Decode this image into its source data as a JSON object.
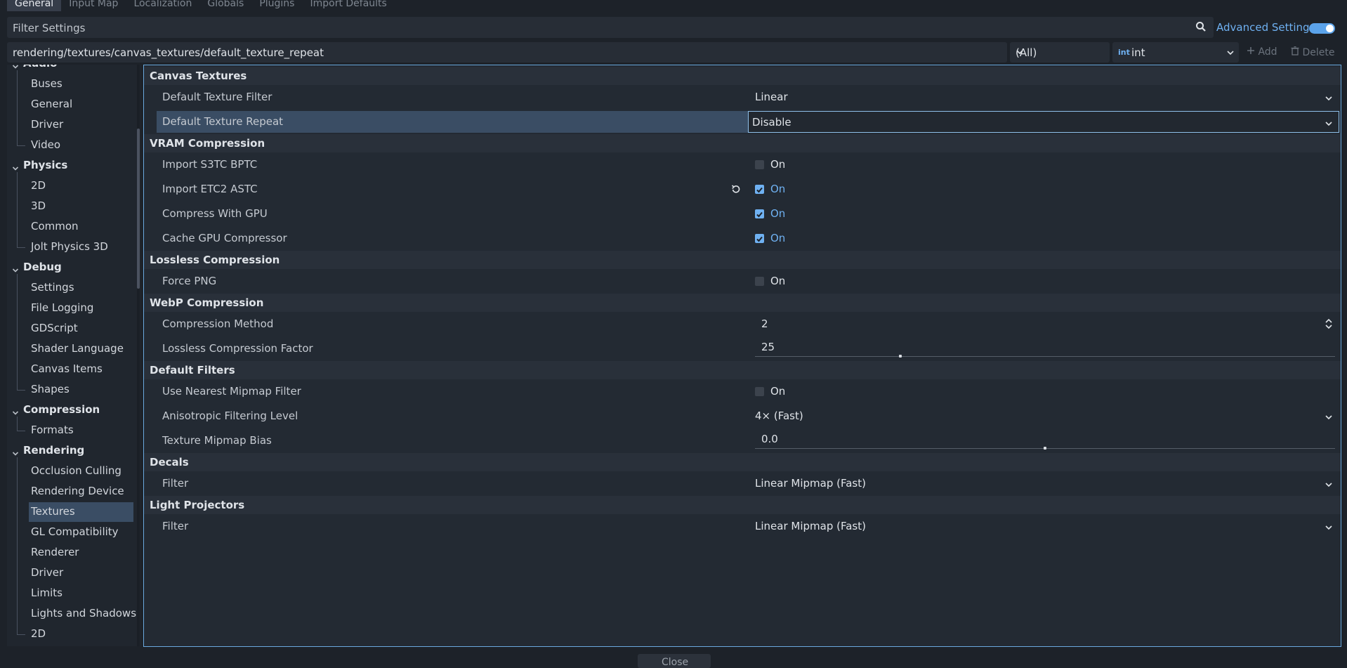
{
  "tabs": [
    "General",
    "Input Map",
    "Localization",
    "Globals",
    "Plugins",
    "Import Defaults"
  ],
  "filter": {
    "placeholder": "Filter Settings"
  },
  "advanced": {
    "label": "Advanced Settings",
    "enabled": true
  },
  "path": "rendering/textures/canvas_textures/default_texture_repeat",
  "type_filter": {
    "value": "(All)"
  },
  "type_select": {
    "badge": "int",
    "value": "int"
  },
  "add_label": "Add",
  "delete_label": "Delete",
  "sidebar": {
    "items": [
      {
        "label": "Audio",
        "kind": "cat"
      },
      {
        "label": "Buses",
        "kind": "sub"
      },
      {
        "label": "General",
        "kind": "sub"
      },
      {
        "label": "Driver",
        "kind": "sub"
      },
      {
        "label": "Video",
        "kind": "sub"
      },
      {
        "label": "Physics",
        "kind": "cat"
      },
      {
        "label": "2D",
        "kind": "sub"
      },
      {
        "label": "3D",
        "kind": "sub"
      },
      {
        "label": "Common",
        "kind": "sub"
      },
      {
        "label": "Jolt Physics 3D",
        "kind": "sub"
      },
      {
        "label": "Debug",
        "kind": "cat"
      },
      {
        "label": "Settings",
        "kind": "sub"
      },
      {
        "label": "File Logging",
        "kind": "sub"
      },
      {
        "label": "GDScript",
        "kind": "sub"
      },
      {
        "label": "Shader Language",
        "kind": "sub"
      },
      {
        "label": "Canvas Items",
        "kind": "sub"
      },
      {
        "label": "Shapes",
        "kind": "sub"
      },
      {
        "label": "Compression",
        "kind": "cat"
      },
      {
        "label": "Formats",
        "kind": "sub"
      },
      {
        "label": "Rendering",
        "kind": "cat"
      },
      {
        "label": "Occlusion Culling",
        "kind": "sub"
      },
      {
        "label": "Rendering Device",
        "kind": "sub"
      },
      {
        "label": "Textures",
        "kind": "sub",
        "selected": true
      },
      {
        "label": "GL Compatibility",
        "kind": "sub"
      },
      {
        "label": "Renderer",
        "kind": "sub"
      },
      {
        "label": "Driver",
        "kind": "sub"
      },
      {
        "label": "Limits",
        "kind": "sub"
      },
      {
        "label": "Lights and Shadows",
        "kind": "sub"
      },
      {
        "label": "2D",
        "kind": "sub"
      }
    ]
  },
  "inspector": {
    "rows": [
      {
        "kind": "cat",
        "label": "Canvas Textures"
      },
      {
        "kind": "prop",
        "label": "Default Texture Filter",
        "type": "dropdown",
        "value": "Linear"
      },
      {
        "kind": "prop",
        "label": "Default Texture Repeat",
        "type": "dropdown",
        "value": "Disable",
        "selected": true
      },
      {
        "kind": "cat",
        "label": "VRAM Compression"
      },
      {
        "kind": "prop",
        "label": "Import S3TC BPTC",
        "type": "check",
        "checked": false,
        "text": "On"
      },
      {
        "kind": "prop",
        "label": "Import ETC2 ASTC",
        "type": "check",
        "checked": true,
        "text": "On",
        "revert": true
      },
      {
        "kind": "prop",
        "label": "Compress With GPU",
        "type": "check",
        "checked": true,
        "text": "On"
      },
      {
        "kind": "prop",
        "label": "Cache GPU Compressor",
        "type": "check",
        "checked": true,
        "text": "On"
      },
      {
        "kind": "cat",
        "label": "Lossless Compression"
      },
      {
        "kind": "prop",
        "label": "Force PNG",
        "type": "check",
        "checked": false,
        "text": "On"
      },
      {
        "kind": "cat",
        "label": "WebP Compression"
      },
      {
        "kind": "prop",
        "label": "Compression Method",
        "type": "number",
        "value": "2"
      },
      {
        "kind": "prop",
        "label": "Lossless Compression Factor",
        "type": "slider",
        "value": "25",
        "level": 0.25
      },
      {
        "kind": "cat",
        "label": "Default Filters"
      },
      {
        "kind": "prop",
        "label": "Use Nearest Mipmap Filter",
        "type": "check",
        "checked": false,
        "text": "On"
      },
      {
        "kind": "prop",
        "label": "Anisotropic Filtering Level",
        "type": "dropdown",
        "value": "4× (Fast)"
      },
      {
        "kind": "prop",
        "label": "Texture Mipmap Bias",
        "type": "slider",
        "value": "0.0",
        "level": 0.5
      },
      {
        "kind": "cat",
        "label": "Decals"
      },
      {
        "kind": "prop",
        "label": "Filter",
        "type": "dropdown",
        "value": "Linear Mipmap (Fast)"
      },
      {
        "kind": "cat",
        "label": "Light Projectors"
      },
      {
        "kind": "prop",
        "label": "Filter",
        "type": "dropdown",
        "value": "Linear Mipmap (Fast)"
      }
    ]
  },
  "close_label": "Close",
  "colors": {
    "accent": "#6fb1f2",
    "selection": "#3a4d64",
    "background": "#1d2229"
  }
}
